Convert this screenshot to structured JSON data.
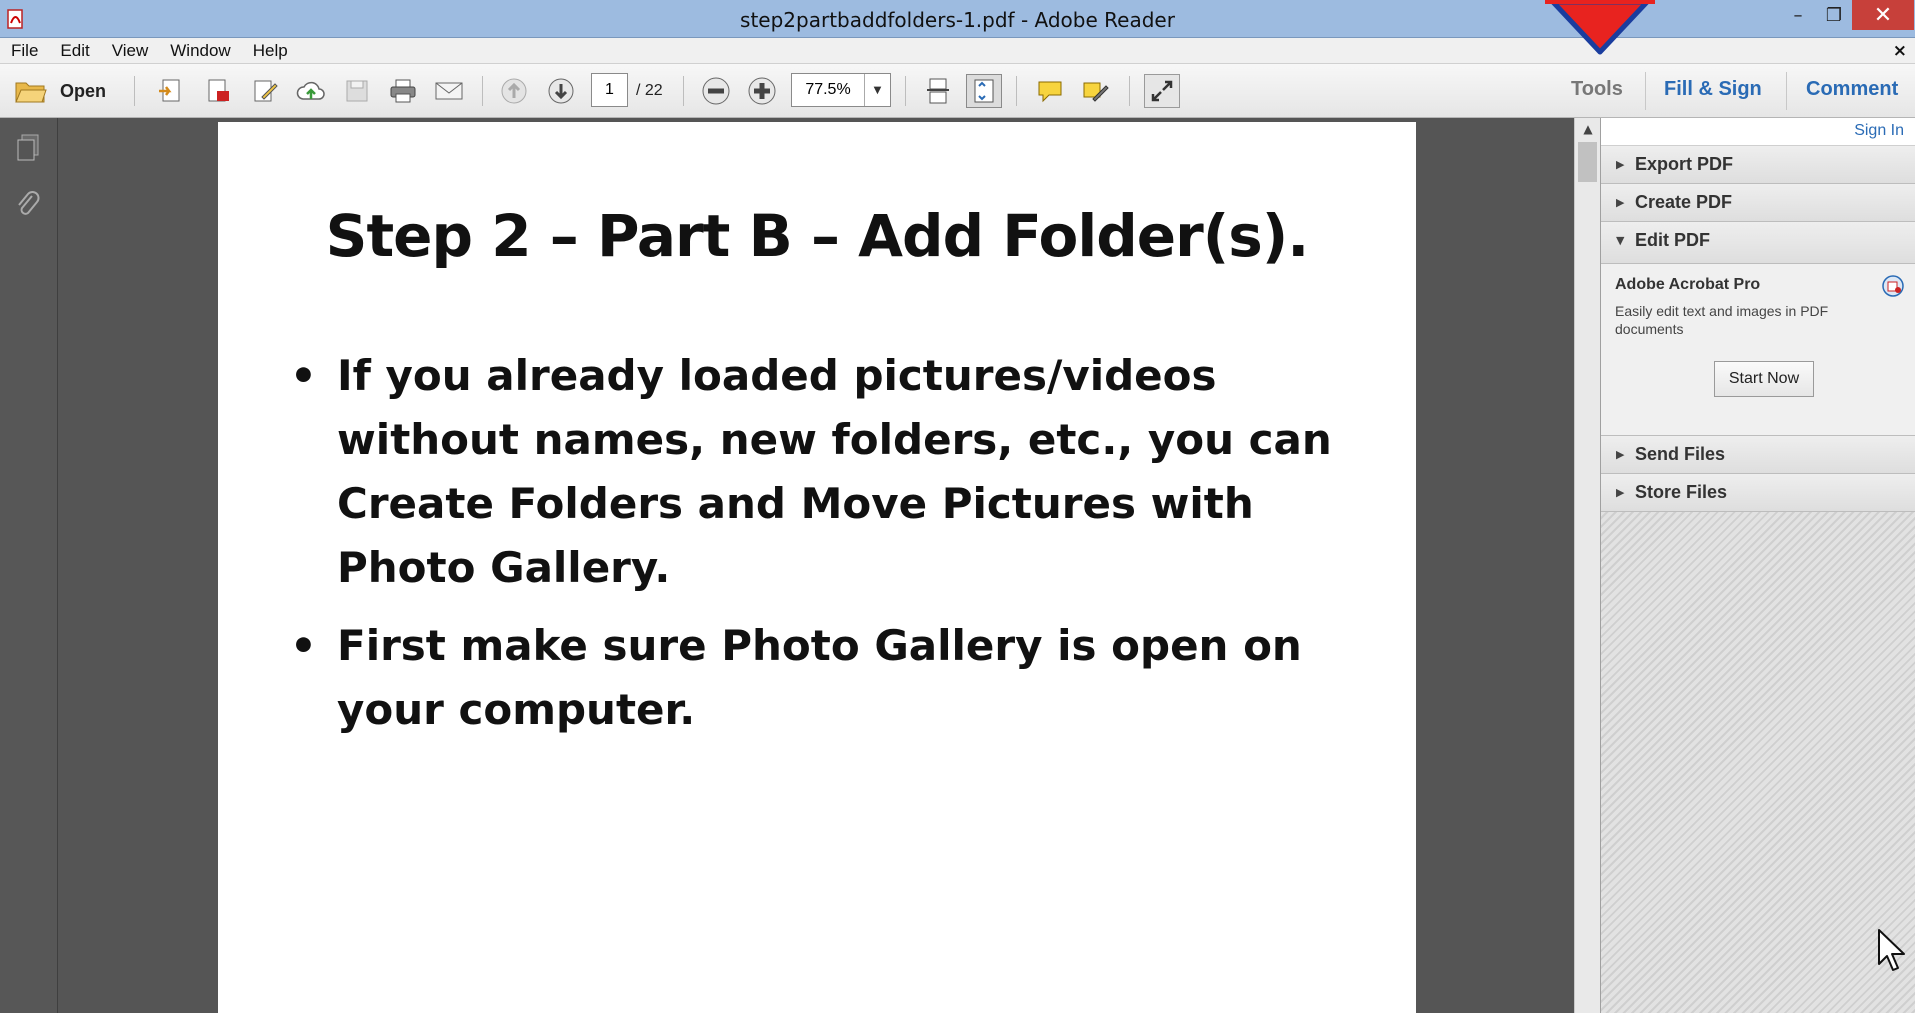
{
  "window": {
    "title": "step2partbaddfolders-1.pdf - Adobe Reader",
    "minimize_glyph": "–",
    "maximize_glyph": "❐",
    "close_glyph": "✕"
  },
  "menu": {
    "items": [
      "File",
      "Edit",
      "View",
      "Window",
      "Help"
    ],
    "close_glyph": "×"
  },
  "toolbar": {
    "open_label": "Open",
    "page_current": "1",
    "page_total": "/ 22",
    "zoom": "77.5%",
    "zoom_dropdown_glyph": "▼"
  },
  "panel_tabs": {
    "tools": "Tools",
    "fill_sign": "Fill & Sign",
    "comment": "Comment"
  },
  "document": {
    "title": "Step 2 – Part B – Add Folder(s).",
    "bullet_glyph": "•",
    "bullets": [
      "If you already loaded pictures/videos without names, new folders, etc., you can Create Folders and Move Pictures with Photo Gallery.",
      "First make sure Photo Gallery is open on your computer."
    ]
  },
  "right_panel": {
    "sign_in": "Sign In",
    "sections": [
      {
        "label": "Export PDF",
        "tri": "▶"
      },
      {
        "label": "Create PDF",
        "tri": "▶"
      },
      {
        "label": "Edit PDF",
        "tri": "▼"
      },
      {
        "label": "Send Files",
        "tri": "▶"
      },
      {
        "label": "Store Files",
        "tri": "▶"
      }
    ],
    "acrobat": {
      "title": "Adobe Acrobat Pro",
      "description": "Easily edit text and images in PDF documents",
      "button": "Start Now"
    }
  },
  "scrollbar": {
    "up_glyph": "▲"
  },
  "colors": {
    "titlebar": "#9dbbe0",
    "close_button": "#c7403a",
    "link_blue": "#2a6bb5",
    "annotation_arrow": "#e8231f"
  }
}
